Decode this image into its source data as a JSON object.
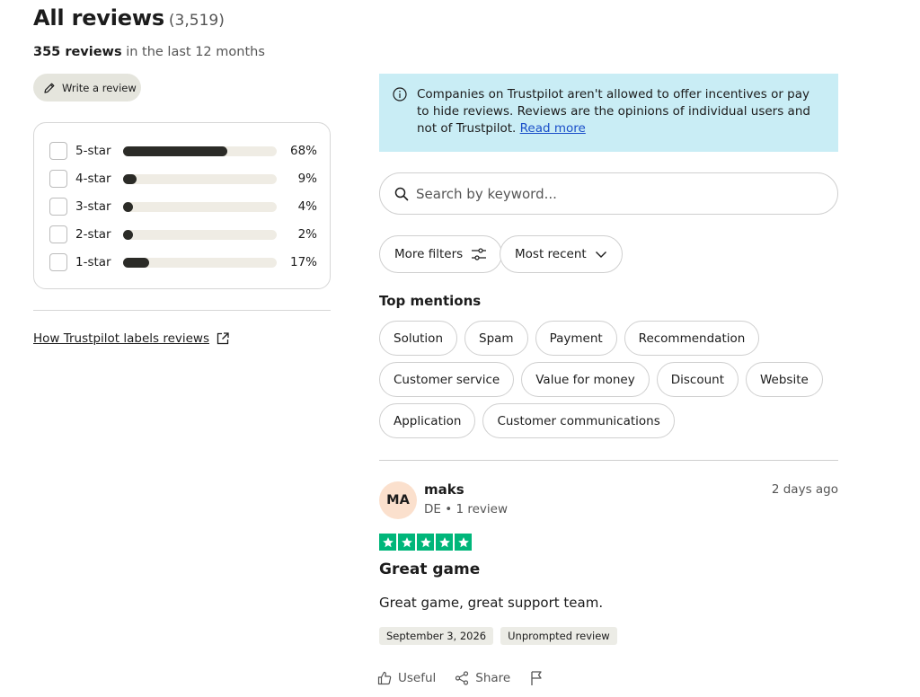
{
  "header": {
    "title": "All reviews",
    "total_count": "(3,519)",
    "recent_count": "355 reviews",
    "recent_suffix": "in the last 12 months",
    "write_review_label": "Write a review"
  },
  "distribution": [
    {
      "label": "5-star",
      "percent": 68,
      "percent_text": "68%"
    },
    {
      "label": "4-star",
      "percent": 9,
      "percent_text": "9%"
    },
    {
      "label": "3-star",
      "percent": 4,
      "percent_text": "4%"
    },
    {
      "label": "2-star",
      "percent": 2,
      "percent_text": "2%"
    },
    {
      "label": "1-star",
      "percent": 17,
      "percent_text": "17%"
    }
  ],
  "how_link": "How Trustpilot labels reviews",
  "notice": {
    "text": "Companies on Trustpilot aren't allowed to offer incentives or pay to hide reviews. Reviews are the opinions of individual users and not of Trustpilot.",
    "link": "Read more",
    "background": "#c9edf5"
  },
  "search": {
    "placeholder": "Search by keyword..."
  },
  "filters": {
    "more_filters": "More filters",
    "sort": "Most recent"
  },
  "mentions": {
    "title": "Top mentions",
    "chips": [
      "Solution",
      "Spam",
      "Payment",
      "Recommendation",
      "Customer service",
      "Value for money",
      "Discount",
      "Website",
      "Application",
      "Customer communications"
    ]
  },
  "review": {
    "initials": "MA",
    "name": "maks",
    "meta": "DE • 1 review",
    "date_ago": "2 days ago",
    "rating": 5,
    "star_color": "#00b67a",
    "title": "Great game",
    "body": "Great game, great support team.",
    "date": "September 3, 2026",
    "badge": "Unprompted review",
    "useful_label": "Useful",
    "share_label": "Share"
  },
  "icons": {
    "write": "pencil-icon",
    "external": "external-link-icon",
    "info": "info-icon",
    "search": "search-icon",
    "filters": "sliders-icon",
    "sort": "chevron-down-icon",
    "useful": "thumbs-up-icon",
    "share": "share-icon",
    "flag": "flag-icon"
  }
}
